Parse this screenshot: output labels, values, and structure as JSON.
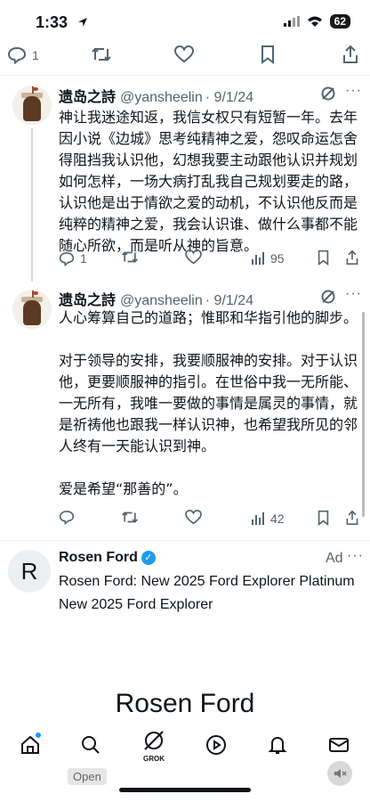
{
  "status_bar": {
    "time": "1:33",
    "battery": "62"
  },
  "top_actions": {
    "replies": "1"
  },
  "tweets": [
    {
      "name": "遗岛之詩",
      "handle": "@yansheelin",
      "date": "· 9/1/24",
      "body": "神让我迷途知返，我信女权只有短暂一年。去年因小说《边城》思考纯精神之爱，怨叹命运怎舍得阻挡我认识他，幻想我要主动跟他认识并规划如何怎样，一场大病打乱我自己规划要走的路，认识他是出于情欲之爱的动机，不认识他反而是纯粹的精神之爱，我会认识谁、做什么事都不能随心所欲，而是听从神的旨意。",
      "replies": "1",
      "views": "95"
    },
    {
      "name": "遗岛之詩",
      "handle": "@yansheelin",
      "date": "· 9/1/24",
      "body": "人心筹算自己的道路；惟耶和华指引他的脚步。\n\n对于领导的安排，我要顺服神的安排。对于认识他，更要顺服神的指引。在世俗中我一无所能、一无所有，我唯一要做的事情是属灵的事情，就是祈祷他也跟我一样认识神，也希望我所见的邻人终有一天能认识到神。\n\n爱是希望“那善的”。",
      "views": "42"
    }
  ],
  "ad": {
    "avatar_letter": "R",
    "name": "Rosen Ford",
    "label": "Ad",
    "line1": "Rosen Ford: New 2025 Ford Explorer Platinum",
    "line2": "New 2025 Ford Explorer",
    "brand_big": "Rosen Ford"
  },
  "bottom_nav": {
    "grok_label": "GROK",
    "open_chip": "Open"
  }
}
